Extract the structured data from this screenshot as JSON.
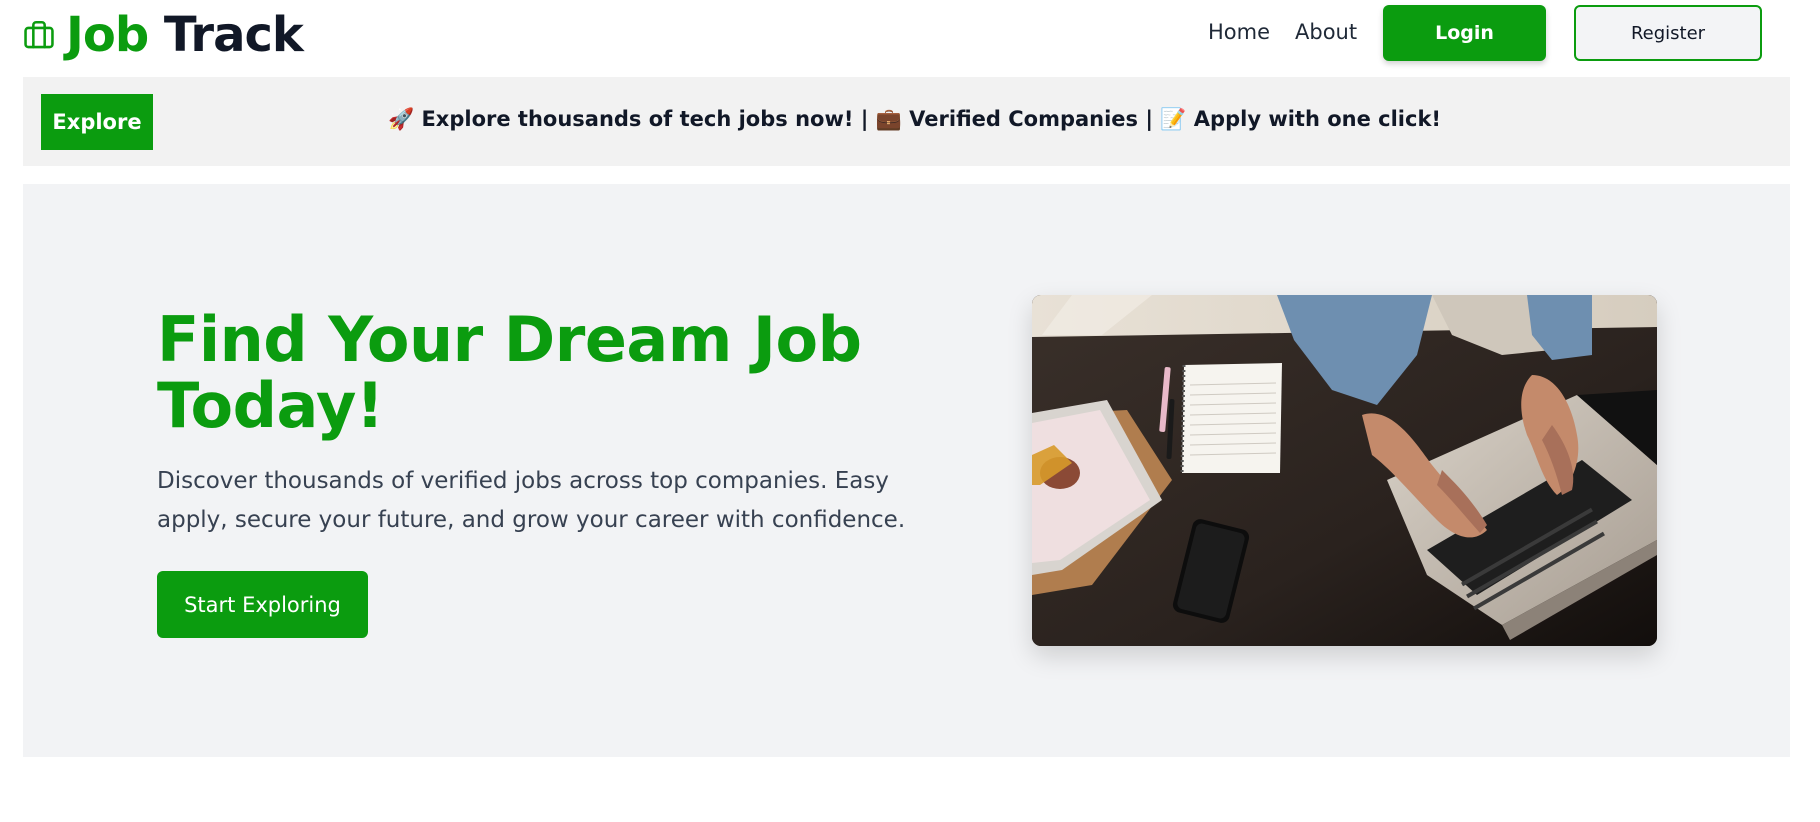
{
  "brand": {
    "icon": "briefcase-icon",
    "name_part1": "Job",
    "name_part2": "Track",
    "accent_color": "#0b9c0f"
  },
  "nav": {
    "home": "Home",
    "about": "About",
    "login": "Login",
    "register": "Register"
  },
  "ticker": {
    "badge": "Explore",
    "message": "🚀 Explore thousands of tech jobs now! | 💼 Verified Companies | 📝 Apply with one click!"
  },
  "hero": {
    "title": "Find Your Dream Job Today!",
    "description": "Discover thousands of verified jobs across top companies. Easy apply, secure your future, and grow your career with confidence.",
    "cta": "Start Exploring",
    "image": "photo of hands typing on a laptop on a desk with notebook and phone"
  }
}
